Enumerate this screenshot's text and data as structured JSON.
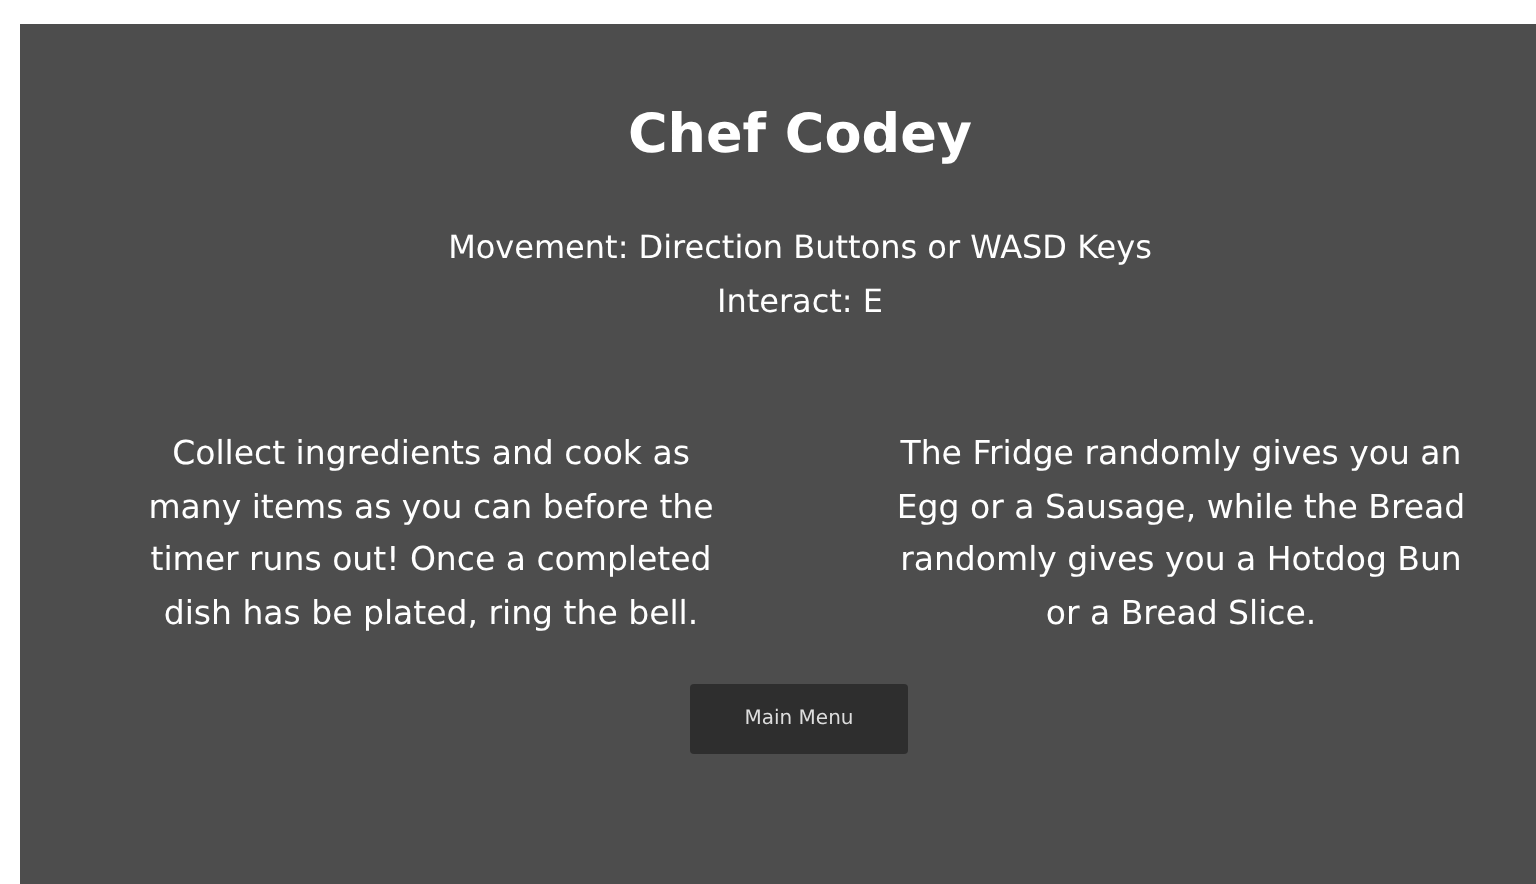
{
  "title": "Chef Codey",
  "controls": [
    "Movement: Direction Buttons or WASD Keys",
    "Interact: E"
  ],
  "paragraphs": [
    {
      "lines": [
        "Collect ingredients and cook as",
        "many items as you can before the",
        "timer runs out! Once a completed",
        "dish has be plated, ring the bell."
      ]
    },
    {
      "lines": [
        "The Fridge randomly gives you an",
        "Egg or a Sausage, while the Bread",
        "randomly gives you a Hotdog Bun",
        "or a Bread Slice."
      ]
    }
  ],
  "button": "Main Menu"
}
